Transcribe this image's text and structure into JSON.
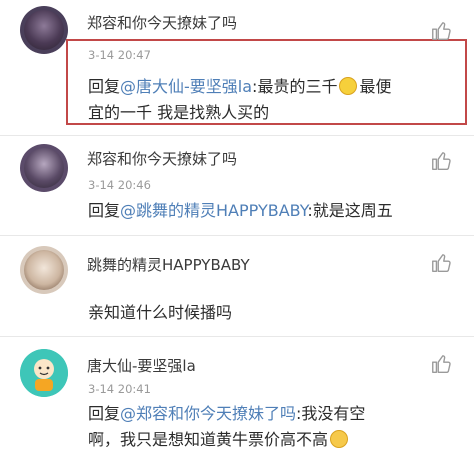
{
  "colors": {
    "mention": "#4f7fb7",
    "highlight_border": "#c24848",
    "timestamp": "#9a9a9a",
    "divider": "#e8e8e8"
  },
  "comments": [
    {
      "username": "郑容和你今天撩妹了吗",
      "time": "3-14 20:47",
      "reply_prefix": "回复",
      "mention": "@唐大仙-要坚强la",
      "text_line1": ":最贵的三千",
      "text_after_emoji": "最便",
      "text_line2": "宜的一千 我是找熟人买的",
      "avatar": "user-avatar-dark"
    },
    {
      "username": "郑容和你今天撩妹了吗",
      "time": "3-14 20:46",
      "reply_prefix": "回复",
      "mention": "@跳舞的精灵HAPPYBABY",
      "text_line1": ":就是这周五",
      "avatar": "user-avatar-dark"
    },
    {
      "username": "跳舞的精灵HAPPYBABY",
      "time": "",
      "text_line1": "亲知道什么时候播吗",
      "avatar": "user-avatar-girl"
    },
    {
      "username": "唐大仙-要坚强la",
      "time": "3-14 20:41",
      "reply_prefix": "回复",
      "mention": "@郑容和你今天撩妹了吗",
      "text_line1": ":我没有空",
      "text_line2": "啊，我只是想知道黄牛票价高不高",
      "avatar": "user-avatar-cartoon"
    }
  ],
  "icons": {
    "like": "thumbs-up-icon",
    "smile": "smile-emoji-icon",
    "cry": "crying-emoji-icon"
  }
}
